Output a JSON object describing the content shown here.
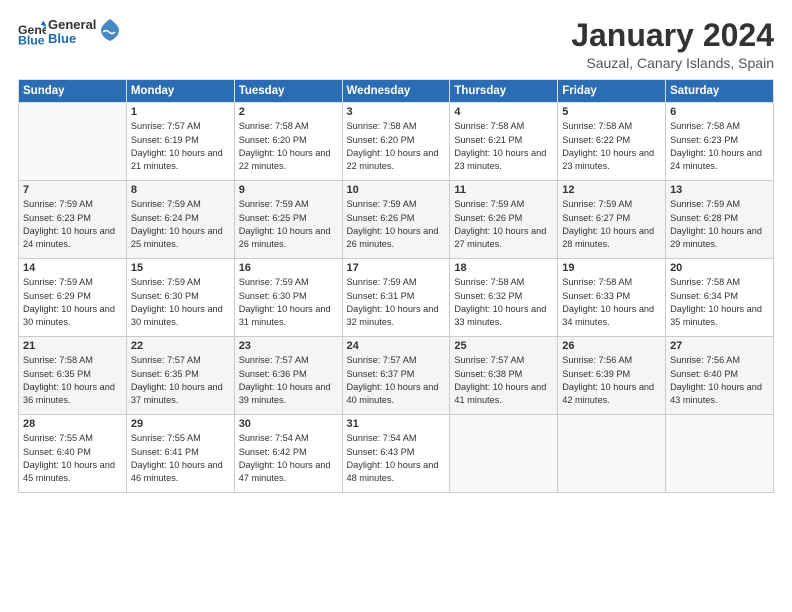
{
  "logo": {
    "general": "General",
    "blue": "Blue"
  },
  "header": {
    "title": "January 2024",
    "location": "Sauzal, Canary Islands, Spain"
  },
  "days": [
    "Sunday",
    "Monday",
    "Tuesday",
    "Wednesday",
    "Thursday",
    "Friday",
    "Saturday"
  ],
  "weeks": [
    [
      {
        "num": "",
        "sunrise": "",
        "sunset": "",
        "daylight": ""
      },
      {
        "num": "1",
        "sunrise": "Sunrise: 7:57 AM",
        "sunset": "Sunset: 6:19 PM",
        "daylight": "Daylight: 10 hours and 21 minutes."
      },
      {
        "num": "2",
        "sunrise": "Sunrise: 7:58 AM",
        "sunset": "Sunset: 6:20 PM",
        "daylight": "Daylight: 10 hours and 22 minutes."
      },
      {
        "num": "3",
        "sunrise": "Sunrise: 7:58 AM",
        "sunset": "Sunset: 6:20 PM",
        "daylight": "Daylight: 10 hours and 22 minutes."
      },
      {
        "num": "4",
        "sunrise": "Sunrise: 7:58 AM",
        "sunset": "Sunset: 6:21 PM",
        "daylight": "Daylight: 10 hours and 23 minutes."
      },
      {
        "num": "5",
        "sunrise": "Sunrise: 7:58 AM",
        "sunset": "Sunset: 6:22 PM",
        "daylight": "Daylight: 10 hours and 23 minutes."
      },
      {
        "num": "6",
        "sunrise": "Sunrise: 7:58 AM",
        "sunset": "Sunset: 6:23 PM",
        "daylight": "Daylight: 10 hours and 24 minutes."
      }
    ],
    [
      {
        "num": "7",
        "sunrise": "Sunrise: 7:59 AM",
        "sunset": "Sunset: 6:23 PM",
        "daylight": "Daylight: 10 hours and 24 minutes."
      },
      {
        "num": "8",
        "sunrise": "Sunrise: 7:59 AM",
        "sunset": "Sunset: 6:24 PM",
        "daylight": "Daylight: 10 hours and 25 minutes."
      },
      {
        "num": "9",
        "sunrise": "Sunrise: 7:59 AM",
        "sunset": "Sunset: 6:25 PM",
        "daylight": "Daylight: 10 hours and 26 minutes."
      },
      {
        "num": "10",
        "sunrise": "Sunrise: 7:59 AM",
        "sunset": "Sunset: 6:26 PM",
        "daylight": "Daylight: 10 hours and 26 minutes."
      },
      {
        "num": "11",
        "sunrise": "Sunrise: 7:59 AM",
        "sunset": "Sunset: 6:26 PM",
        "daylight": "Daylight: 10 hours and 27 minutes."
      },
      {
        "num": "12",
        "sunrise": "Sunrise: 7:59 AM",
        "sunset": "Sunset: 6:27 PM",
        "daylight": "Daylight: 10 hours and 28 minutes."
      },
      {
        "num": "13",
        "sunrise": "Sunrise: 7:59 AM",
        "sunset": "Sunset: 6:28 PM",
        "daylight": "Daylight: 10 hours and 29 minutes."
      }
    ],
    [
      {
        "num": "14",
        "sunrise": "Sunrise: 7:59 AM",
        "sunset": "Sunset: 6:29 PM",
        "daylight": "Daylight: 10 hours and 30 minutes."
      },
      {
        "num": "15",
        "sunrise": "Sunrise: 7:59 AM",
        "sunset": "Sunset: 6:30 PM",
        "daylight": "Daylight: 10 hours and 30 minutes."
      },
      {
        "num": "16",
        "sunrise": "Sunrise: 7:59 AM",
        "sunset": "Sunset: 6:30 PM",
        "daylight": "Daylight: 10 hours and 31 minutes."
      },
      {
        "num": "17",
        "sunrise": "Sunrise: 7:59 AM",
        "sunset": "Sunset: 6:31 PM",
        "daylight": "Daylight: 10 hours and 32 minutes."
      },
      {
        "num": "18",
        "sunrise": "Sunrise: 7:58 AM",
        "sunset": "Sunset: 6:32 PM",
        "daylight": "Daylight: 10 hours and 33 minutes."
      },
      {
        "num": "19",
        "sunrise": "Sunrise: 7:58 AM",
        "sunset": "Sunset: 6:33 PM",
        "daylight": "Daylight: 10 hours and 34 minutes."
      },
      {
        "num": "20",
        "sunrise": "Sunrise: 7:58 AM",
        "sunset": "Sunset: 6:34 PM",
        "daylight": "Daylight: 10 hours and 35 minutes."
      }
    ],
    [
      {
        "num": "21",
        "sunrise": "Sunrise: 7:58 AM",
        "sunset": "Sunset: 6:35 PM",
        "daylight": "Daylight: 10 hours and 36 minutes."
      },
      {
        "num": "22",
        "sunrise": "Sunrise: 7:57 AM",
        "sunset": "Sunset: 6:35 PM",
        "daylight": "Daylight: 10 hours and 37 minutes."
      },
      {
        "num": "23",
        "sunrise": "Sunrise: 7:57 AM",
        "sunset": "Sunset: 6:36 PM",
        "daylight": "Daylight: 10 hours and 39 minutes."
      },
      {
        "num": "24",
        "sunrise": "Sunrise: 7:57 AM",
        "sunset": "Sunset: 6:37 PM",
        "daylight": "Daylight: 10 hours and 40 minutes."
      },
      {
        "num": "25",
        "sunrise": "Sunrise: 7:57 AM",
        "sunset": "Sunset: 6:38 PM",
        "daylight": "Daylight: 10 hours and 41 minutes."
      },
      {
        "num": "26",
        "sunrise": "Sunrise: 7:56 AM",
        "sunset": "Sunset: 6:39 PM",
        "daylight": "Daylight: 10 hours and 42 minutes."
      },
      {
        "num": "27",
        "sunrise": "Sunrise: 7:56 AM",
        "sunset": "Sunset: 6:40 PM",
        "daylight": "Daylight: 10 hours and 43 minutes."
      }
    ],
    [
      {
        "num": "28",
        "sunrise": "Sunrise: 7:55 AM",
        "sunset": "Sunset: 6:40 PM",
        "daylight": "Daylight: 10 hours and 45 minutes."
      },
      {
        "num": "29",
        "sunrise": "Sunrise: 7:55 AM",
        "sunset": "Sunset: 6:41 PM",
        "daylight": "Daylight: 10 hours and 46 minutes."
      },
      {
        "num": "30",
        "sunrise": "Sunrise: 7:54 AM",
        "sunset": "Sunset: 6:42 PM",
        "daylight": "Daylight: 10 hours and 47 minutes."
      },
      {
        "num": "31",
        "sunrise": "Sunrise: 7:54 AM",
        "sunset": "Sunset: 6:43 PM",
        "daylight": "Daylight: 10 hours and 48 minutes."
      },
      {
        "num": "",
        "sunrise": "",
        "sunset": "",
        "daylight": ""
      },
      {
        "num": "",
        "sunrise": "",
        "sunset": "",
        "daylight": ""
      },
      {
        "num": "",
        "sunrise": "",
        "sunset": "",
        "daylight": ""
      }
    ]
  ]
}
